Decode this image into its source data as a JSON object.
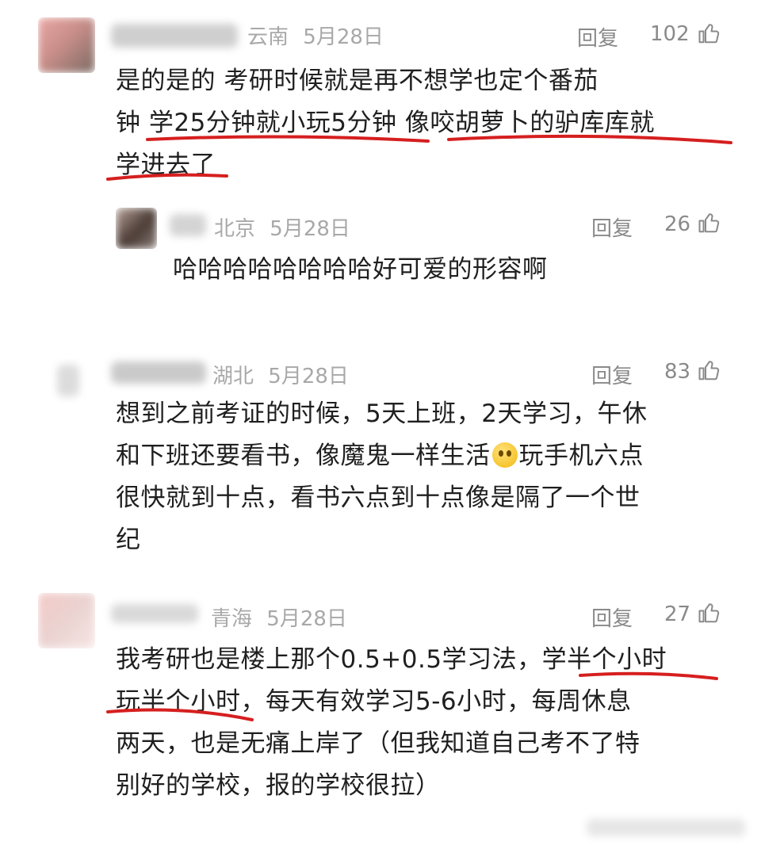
{
  "comments": [
    {
      "region": "云南",
      "date": "5月28日",
      "reply_label": "回复",
      "likes": "102",
      "lines": [
        "是的是的 考研时候就是再不想学也定个番茄",
        "钟 学25分钟就小玩5分钟 像咬胡萝卜的驴库库就",
        "学进去了"
      ]
    },
    {
      "region": "北京",
      "date": "5月28日",
      "reply_label": "回复",
      "likes": "26",
      "lines": [
        "哈哈哈哈哈哈哈哈好可爱的形容啊"
      ]
    },
    {
      "region": "湖北",
      "date": "5月28日",
      "reply_label": "回复",
      "likes": "83",
      "lines": [
        "想到之前考证的时候，5天上班，2天学习，午休",
        "和下班还要看书，像魔鬼一样生活",
        "玩手机六点",
        "很快就到十点，看书六点到十点像是隔了一个世",
        "纪"
      ]
    },
    {
      "region": "青海",
      "date": "5月28日",
      "reply_label": "回复",
      "likes": "27",
      "lines": [
        "我考研也是楼上那个0.5+0.5学习法，学半个小时",
        "玩半个小时，每天有效学习5-6小时，每周休息",
        "两天，也是无痛上岸了（但我知道自己考不了特",
        "别好的学校，报的学校很拉）"
      ]
    }
  ],
  "icons": {
    "like": "thumbs-up-icon",
    "emoji": "crying-face-emoji-icon"
  },
  "colors": {
    "underline": "#d61f1f",
    "meta": "#a8a8a8",
    "text": "#1f1f1f"
  }
}
